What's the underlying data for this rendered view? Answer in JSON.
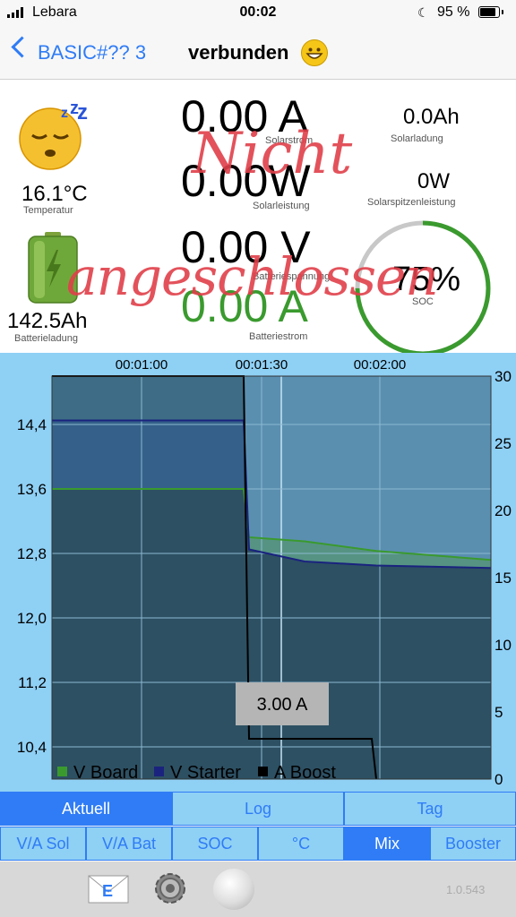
{
  "status_bar": {
    "carrier": "Lebara",
    "time": "00:02",
    "battery_pct": "95 %",
    "battery_level": 0.95
  },
  "nav": {
    "back_label": "BASIC#?? 3",
    "title": "verbunden"
  },
  "dashboard": {
    "temperature": {
      "value": "16.1°C",
      "label": "Temperatur"
    },
    "battery_charge": {
      "value": "142.5Ah",
      "label": "Batterieladung"
    },
    "solar_current": {
      "value": "0.00 A",
      "label": "Solarstrom"
    },
    "solar_power": {
      "value": "0.00W",
      "label": "Solarleistung"
    },
    "battery_voltage": {
      "value": "0.00 V",
      "label": "Batteriespannung"
    },
    "battery_current": {
      "value": "0.00 A",
      "label": "Batteriestrom"
    },
    "solar_charge": {
      "value": "0.0Ah",
      "label": "Solarladung"
    },
    "solar_peak": {
      "value": "0W",
      "label": "Solarspitzenleistung"
    },
    "soc": {
      "value": "75%",
      "label": "SOC",
      "fraction": 0.75
    },
    "overlay_line1": "Nicht",
    "overlay_line2": "angeschlossen"
  },
  "chart_data": {
    "type": "area",
    "x_ticks": [
      "00:01:00",
      "00:01:30",
      "00:02:00"
    ],
    "y_left_ticks": [
      "14,4",
      "13,6",
      "12,8",
      "12,0",
      "11,2",
      "10,4"
    ],
    "y_right_ticks": [
      "30",
      "25",
      "20",
      "15",
      "10",
      "5",
      "0"
    ],
    "legend": [
      "V Board",
      "V Starter",
      "A Boost"
    ],
    "tooltip": "3.00 A",
    "series": [
      {
        "name": "V Board",
        "axis": "left",
        "values_note": "≈13.6 until switch, then ~13.0 decaying to ~12.7"
      },
      {
        "name": "V Starter",
        "axis": "left",
        "values_note": "≈14.4 until switch, then ~12.8 to ~12.6"
      },
      {
        "name": "A Boost",
        "axis": "right",
        "values_note": "≈30 until switch, then ~3 dropping to 0"
      }
    ],
    "colors": {
      "board": "#3a9a2e",
      "starter": "#1a237e",
      "boost": "#000000"
    }
  },
  "tabs_row1": [
    "Aktuell",
    "Log",
    "Tag"
  ],
  "tabs_row2": [
    "V/A Sol",
    "V/A Bat",
    "SOC",
    "°C",
    "Mix",
    "Booster"
  ],
  "active_tab1": "Aktuell",
  "active_tab2": "Mix",
  "version": "1.0.543",
  "colors": {
    "accent": "#2f7cf6",
    "chart_bg": "#8fd0f5",
    "overlay_text": "#e0404a",
    "soc_ring": "#3a9a2e"
  }
}
